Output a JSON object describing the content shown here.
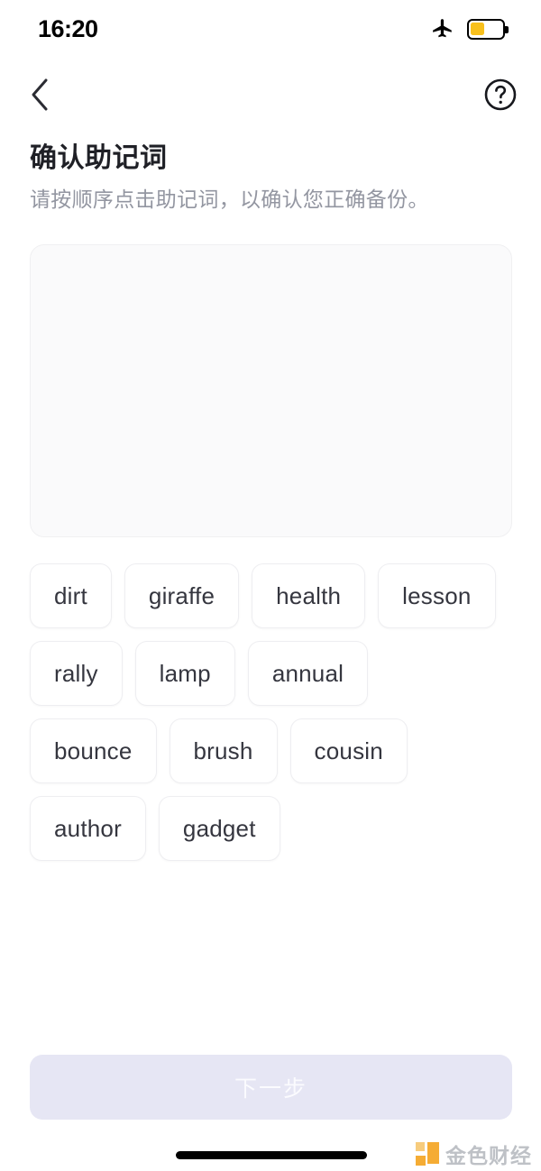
{
  "status_bar": {
    "time": "16:20",
    "airplane_icon": "airplane-mode-icon",
    "battery_icon": "battery-low-power-icon",
    "battery_color": "#f8c01c",
    "battery_level_percent": 45
  },
  "nav_bar": {
    "back_icon": "chevron-left-icon",
    "help_icon": "question-mark-circle-icon"
  },
  "header": {
    "title": "确认助记词",
    "subtitle": "请按顺序点击助记词，以确认您正确备份。"
  },
  "answer_panel": {
    "selected_words": [],
    "background_color": "#fafafb"
  },
  "word_bank": {
    "words": [
      "dirt",
      "giraffe",
      "health",
      "lesson",
      "rally",
      "lamp",
      "annual",
      "bounce",
      "brush",
      "cousin",
      "author",
      "gadget"
    ]
  },
  "footer": {
    "next_label": "下一步",
    "next_enabled": false,
    "next_background_color": "#e6e6f4",
    "next_text_color": "#fbfbfe"
  },
  "watermark": {
    "text": "金色财经",
    "logo_color": "#f5a623"
  }
}
